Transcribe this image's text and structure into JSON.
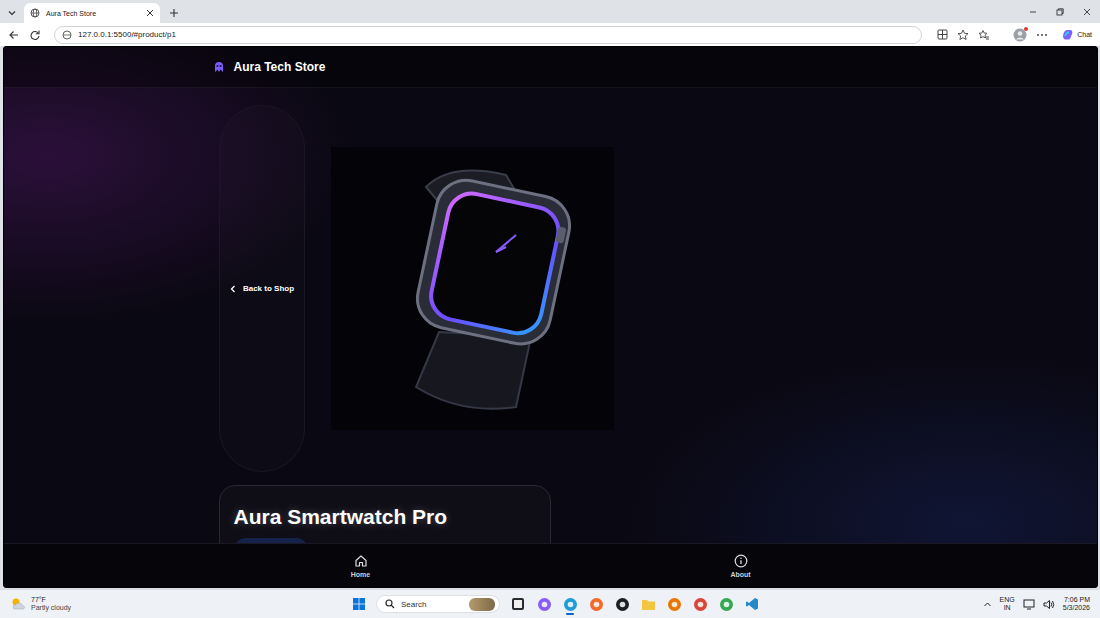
{
  "browser": {
    "tabs": [
      {
        "title": "Aura Tech Store",
        "selected": true
      }
    ],
    "url": "127.0.0.1:5500/#product/p1",
    "chat": "Chat"
  },
  "page": {
    "brand": "Aura Tech Store",
    "back": "Back to Shop",
    "product": {
      "title": "Aura Smartwatch Pro"
    },
    "nav": [
      {
        "label": "Home",
        "kind": "home",
        "selected": false
      },
      {
        "label": "About",
        "kind": "about",
        "selected": false
      }
    ]
  },
  "taskbar": {
    "weather": {
      "temp": "77°F",
      "desc": "Partly cloudy"
    },
    "search": {
      "placeholder": "Search"
    },
    "apps": [
      {
        "kind": "terminal",
        "color": "#2b2b2b",
        "selected": false
      },
      {
        "kind": "copilot",
        "color": "#8a5cf6",
        "selected": false
      },
      {
        "kind": "edge",
        "color": "#1f9bd7",
        "selected": true
      },
      {
        "kind": "firefox",
        "color": "#f2692a",
        "selected": false
      },
      {
        "kind": "github",
        "color": "#1b1f24",
        "selected": false
      },
      {
        "kind": "folder",
        "color": "#f4c542",
        "selected": false
      },
      {
        "kind": "blender",
        "color": "#ea7600",
        "selected": false
      },
      {
        "kind": "chrome",
        "color": "#db4437",
        "selected": false
      },
      {
        "kind": "chrome-dev",
        "color": "#34a853",
        "selected": false
      },
      {
        "kind": "vscode",
        "color": "#2489ca",
        "selected": false
      }
    ],
    "tray": {
      "lang": "ENG",
      "region": "IN",
      "time": "7:06 PM",
      "date": "5/3/2026"
    }
  }
}
